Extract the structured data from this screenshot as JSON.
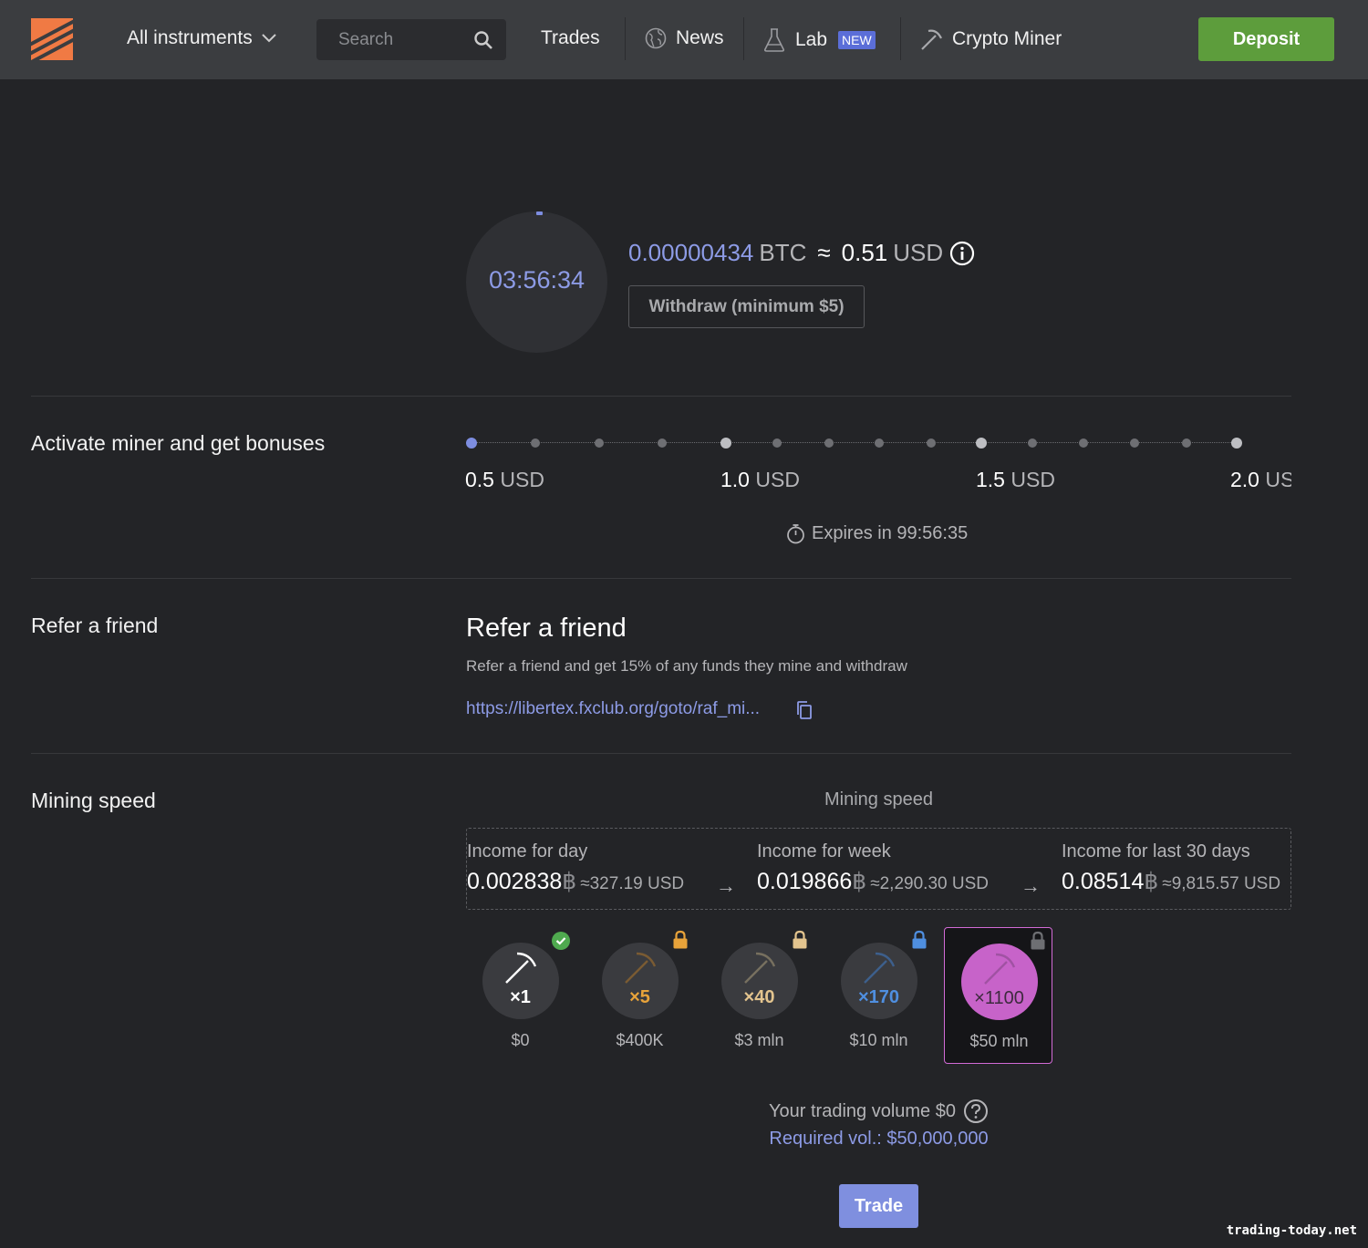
{
  "header": {
    "instruments_label": "All instruments",
    "search_placeholder": "Search",
    "nav": {
      "trades": "Trades",
      "news": "News",
      "lab": "Lab",
      "lab_badge": "NEW",
      "crypto_miner": "Crypto Miner"
    },
    "deposit_label": "Deposit"
  },
  "miner": {
    "timer": "03:56:34",
    "btc_amount": "0.00000434",
    "btc_unit": "BTC",
    "approx": "≈",
    "usd_amount": "0.51",
    "usd_unit": "USD",
    "withdraw_label": "Withdraw (minimum $5)"
  },
  "bonuses": {
    "title": "Activate miner and get bonuses",
    "milestones": [
      {
        "value": "0.5",
        "unit": "USD"
      },
      {
        "value": "1.0",
        "unit": "USD"
      },
      {
        "value": "1.5",
        "unit": "USD"
      },
      {
        "value": "2.0",
        "unit": "USD"
      }
    ],
    "expires": "Expires in 99:56:35"
  },
  "refer": {
    "section_title": "Refer a friend",
    "heading": "Refer a friend",
    "description": "Refer a friend and get 15% of any funds they mine and withdraw",
    "link": "https://libertex.fxclub.org/goto/raf_mi..."
  },
  "mining_speed": {
    "section_title": "Mining speed",
    "caption": "Mining speed",
    "income": [
      {
        "label": "Income for day",
        "btc": "0.002838",
        "symbol": "฿",
        "usd": "≈327.19 USD"
      },
      {
        "label": "Income for week",
        "btc": "0.019866",
        "symbol": "฿",
        "usd": "≈2,290.30 USD"
      },
      {
        "label": "Income for last 30 days",
        "btc": "0.08514",
        "symbol": "฿",
        "usd": "≈9,815.57 USD"
      }
    ],
    "arrow": "→",
    "levels": [
      {
        "mult": "×1",
        "price": "$0",
        "status": "unlocked",
        "color": "#ffffff"
      },
      {
        "mult": "×5",
        "price": "$400K",
        "status": "locked",
        "color": "#e8a33a"
      },
      {
        "mult": "×40",
        "price": "$3 mln",
        "status": "locked",
        "color": "#e3c48e"
      },
      {
        "mult": "×170",
        "price": "$10 mln",
        "status": "locked",
        "color": "#4f8fe0"
      },
      {
        "mult": "×1100",
        "price": "$50 mln",
        "status": "locked-selected",
        "color": "#c763c9"
      }
    ],
    "volume": "Your trading volume $0",
    "required": "Required vol.: $50,000,000",
    "trade_label": "Trade"
  },
  "watermark": "trading-today.net",
  "colors": {
    "accent": "#8d9be6",
    "deposit": "#5d9d3c",
    "logo": "#f07a44",
    "selected": "#d26bd6"
  }
}
